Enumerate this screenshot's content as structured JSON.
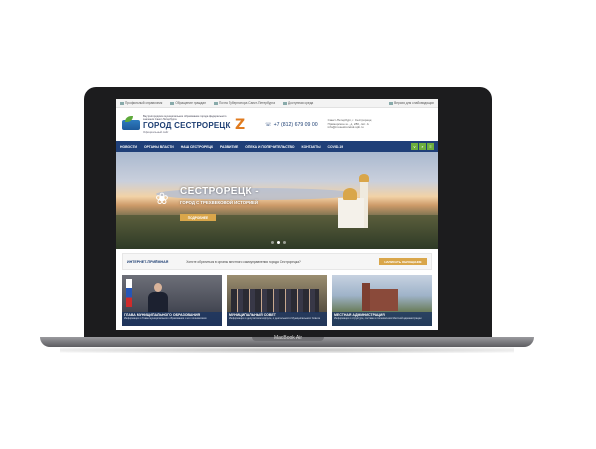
{
  "device": {
    "brand": "MacBook Air"
  },
  "topbar": {
    "links": [
      "Профильный справочник",
      "Обращение граждан",
      "Почта Губернатора Санкт-Петербурга",
      "Доступная среда",
      "Версия для слабовидящих"
    ]
  },
  "header": {
    "org_subtitle": "Внутригородское муниципальное образование города федерального значения Санкт-Петербурга",
    "org_title": "ГОРОД СЕСТРОРЕЦК",
    "org_tagline": "Официальный сайт",
    "z_mark": "Z",
    "phone": "+7 (812) 679 09 00",
    "address": "Санкт-Петербург, г. Сестрорецк, Приморское ш., д. 280, лит. А info@mosestroretsk.spb.ru"
  },
  "nav": {
    "items": [
      "НОВОСТИ",
      "ОРГАНЫ ВЛАСТИ",
      "НАШ СЕСТРОРЕЦК",
      "РАЗВИТИЕ",
      "ОПЕКА И ПОПЕЧИТЕЛЬСТВО",
      "КОНТАКТЫ",
      "COVID-19"
    ]
  },
  "hero": {
    "title": "СЕСТРОРЕЦК -",
    "subtitle": "ГОРОД С ТРЕХВЕКОВОЙ ИСТОРИЕЙ",
    "button": "ПОДРОБНЕЕ"
  },
  "reception": {
    "label": "ИНТЕРНЕТ-ПРИЁМНАЯ",
    "text": "Хотите обратиться в органы местного самоуправления города Сестрорецка?",
    "button": "НАПИСАТЬ ОБРАЩЕНИЕ"
  },
  "cards": [
    {
      "title": "ГЛАВА МУНИЦИПАЛЬНОГО ОБРАЗОВАНИЯ",
      "subtitle": "Информация о Главе муниципального образования и его полномочиях"
    },
    {
      "title": "МУНИЦИПАЛЬНЫЙ СОВЕТ",
      "subtitle": "Информация о депутатском корпусе, о деятельности Муниципального Совета"
    },
    {
      "title": "МЕСТНАЯ АДМИНИСТРАЦИЯ",
      "subtitle": "Информация о структуре, составе и полномочиях Местной администрации"
    }
  ]
}
